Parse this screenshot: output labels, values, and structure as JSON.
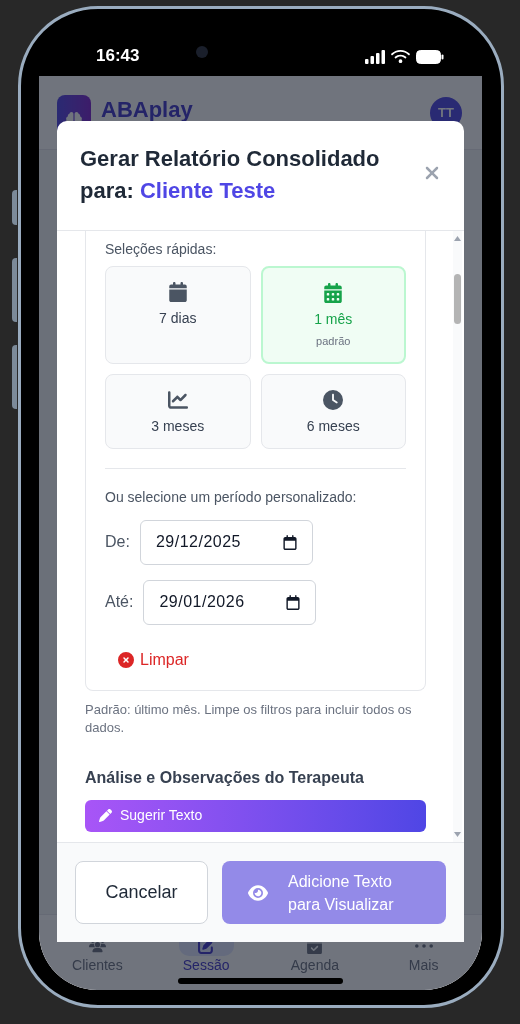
{
  "status_bar": {
    "time": "16:43"
  },
  "app_header": {
    "brand": "ABAplay",
    "avatar": "TT"
  },
  "modal": {
    "title": "Gerar Relatório Consolidado para:",
    "client": "Cliente Teste",
    "quick_selections": {
      "label": "Seleções rápidas:",
      "options": [
        {
          "label": "7 dias",
          "selected": false
        },
        {
          "label": "1 mês",
          "note": "padrão",
          "selected": true
        },
        {
          "label": "3 meses",
          "selected": false
        },
        {
          "label": "6 meses",
          "selected": false
        }
      ]
    },
    "custom_period": {
      "label": "Ou selecione um período personalizado:",
      "fields": [
        {
          "label": "De:",
          "value": "29/12/2025"
        },
        {
          "label": "Até:",
          "value": "29/01/2026"
        }
      ],
      "clear_button": "Limpar"
    },
    "help_text": "Padrão: último mês. Limpe os filtros para incluir todos os dados.",
    "analysis": {
      "heading": "Análise e Observações do Terapeuta",
      "suggest_button": "Sugerir Texto"
    },
    "footer": {
      "cancel": "Cancelar",
      "submit": {
        "label": "Adicione Texto para Visualizar",
        "disabled": true
      }
    }
  },
  "bottom_nav": [
    {
      "label": "Clientes",
      "selected": false
    },
    {
      "label": "Sessão",
      "selected": true
    },
    {
      "label": "Agenda",
      "selected": false
    },
    {
      "label": "Mais",
      "selected": false
    }
  ]
}
